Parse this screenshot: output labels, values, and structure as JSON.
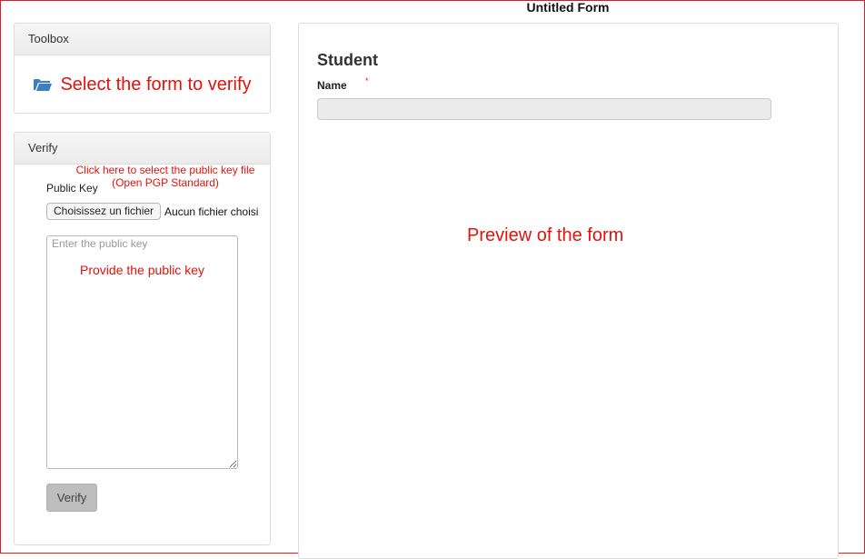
{
  "page": {
    "title": "Untitled Form"
  },
  "toolbox": {
    "heading": "Toolbox",
    "select_label": "Select the form to verify",
    "icon": "folder-open-icon"
  },
  "verify": {
    "heading": "Verify",
    "file_hint_line1": "Click here to select the public key file",
    "file_hint_line2": "(Open PGP Standard)",
    "public_key_label": "Public Key",
    "file_button_label": "Choisissez un fichier",
    "file_status": "Aucun fichier choisi",
    "public_key_placeholder": "Enter the public key",
    "public_key_value": "",
    "provide_hint": "Provide the public key",
    "verify_button_label": "Verify"
  },
  "preview": {
    "form_title": "Student",
    "name_label": "Name",
    "required_marker": "*",
    "name_value": "",
    "preview_hint": "Preview of the form"
  },
  "colors": {
    "annotation_red": "#e3120b",
    "folder_blue": "#3a7fc1",
    "frame_red": "#d9202a"
  }
}
